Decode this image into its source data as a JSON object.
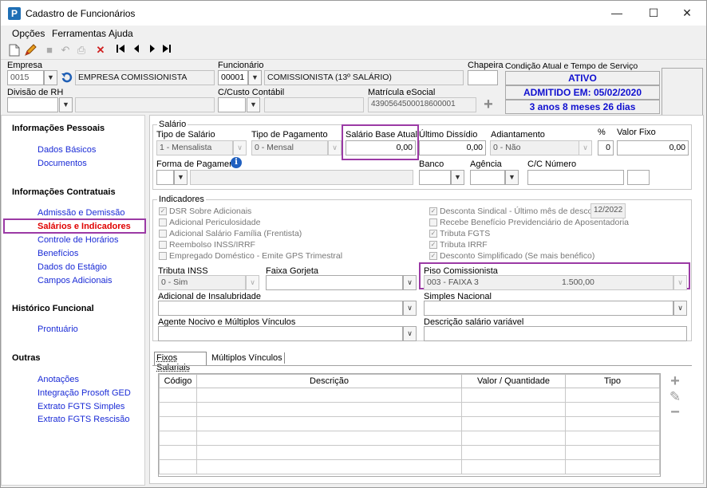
{
  "window": {
    "title": "Cadastro de Funcionários",
    "app_icon": "P"
  },
  "menu": [
    {
      "label": "Opções",
      "accel": "O"
    },
    {
      "label": "Ferramentas",
      "accel": "F"
    },
    {
      "label": "Ajuda",
      "accel": "A"
    }
  ],
  "header": {
    "empresa_label": "Empresa",
    "empresa_code": "0015",
    "empresa_name": "EMPRESA COMISSIONISTA",
    "funcionario_label": "Funcionário",
    "funcionario_code": "00001",
    "funcionario_name": "COMISSIONISTA  (13º SALÁRIO)",
    "chapeira_label": "Chapeira",
    "chapeira_value": "",
    "condicao_label": "Condição Atual e Tempo de Serviço",
    "status": "ATIVO",
    "admitido": "ADMITIDO EM: 05/02/2020",
    "tempo": "3 anos 8 meses 26 dias",
    "divisao_label": "Divisão de RH",
    "divisao_value": "",
    "ccusto_label": "C/Custo Contábil",
    "ccusto_value": "",
    "matricula_label": "Matrícula eSocial",
    "matricula_value": "4390564500018600001"
  },
  "sidebar": {
    "sections": [
      {
        "title": "Informações Pessoais",
        "items": [
          "Dados Básicos",
          "Documentos"
        ]
      },
      {
        "title": "Informações Contratuais",
        "items": [
          "Admissão e Demissão",
          "Salários e Indicadores",
          "Controle de Horários",
          "Benefícios",
          "Dados do Estágio",
          "Campos Adicionais"
        ]
      },
      {
        "title": "Histórico Funcional",
        "items": [
          "Prontuário"
        ]
      },
      {
        "title": "Outras",
        "items": [
          "Anotações",
          "Integração Prosoft GED",
          "Extrato FGTS Simples",
          "Extrato FGTS Rescisão"
        ]
      }
    ],
    "active": "Salários e Indicadores"
  },
  "salario": {
    "group_title": "Salário",
    "tipo_salario_label": "Tipo de Salário",
    "tipo_salario_value": "1 - Mensalista",
    "tipo_pagamento_label": "Tipo de Pagamento",
    "tipo_pagamento_value": "0 - Mensal",
    "salario_base_label": "Salário Base Atual",
    "salario_base_value": "0,00",
    "ultimo_dissidio_label": "Último Dissídio",
    "ultimo_dissidio_value": "0,00",
    "adiantamento_label": "Adiantamento",
    "adiantamento_value": "0 - Não",
    "percent_label": "%",
    "percent_value": "0",
    "valor_fixo_label": "Valor Fixo",
    "valor_fixo_value": "0,00",
    "forma_pagamento_label": "Forma de Pagamento",
    "banco_label": "Banco",
    "agencia_label": "Agência",
    "cc_label": "C/C Número"
  },
  "indicadores": {
    "group_title": "Indicadores",
    "left_checks": [
      {
        "label": "DSR Sobre Adicionais",
        "checked": true
      },
      {
        "label": "Adicional Periculosidade",
        "checked": false
      },
      {
        "label": "Adicional Salário Família (Frentista)",
        "checked": false
      },
      {
        "label": "Reembolso INSS/IRRF",
        "checked": false
      },
      {
        "label": "Empregado Doméstico - Emite GPS Trimestral",
        "checked": false
      }
    ],
    "right_checks": [
      {
        "label": "Desconta Sindical - Último mês de desconto",
        "checked": true
      },
      {
        "label": "Recebe Benefício Previdenciário de Aposentadoria",
        "checked": false
      },
      {
        "label": "Tributa FGTS",
        "checked": true
      },
      {
        "label": "Tributa IRRF",
        "checked": true
      },
      {
        "label": "Desconto Simplificado (Se mais benéfico)",
        "checked": true
      }
    ],
    "sindical_mes": "12/2022",
    "tributa_inss_label": "Tributa INSS",
    "tributa_inss_value": "0 - Sim",
    "faixa_gorjeta_label": "Faixa Gorjeta",
    "piso_label": "Piso Comissionista",
    "piso_code": "003 - FAIXA 3",
    "piso_value": "1.500,00",
    "insalubridade_label": "Adicional de Insalubridade",
    "simples_label": "Simples Nacional",
    "agente_label": "Agente Nocivo e  Múltiplos Vínculos",
    "desc_variavel_label": "Descrição salário variável"
  },
  "tabs": [
    {
      "label": "Fixos Salariais",
      "active": true
    },
    {
      "label": "Múltiplos Vínculos",
      "active": false
    }
  ],
  "grid": {
    "columns": [
      "Código",
      "Descrição",
      "Valor / Quantidade",
      "Tipo"
    ],
    "rows": 6
  },
  "icons": {
    "new": "new-document-icon",
    "edit": "edit-icon",
    "close": "close-x-icon",
    "first": "first-record-icon",
    "prev": "previous-record-icon",
    "next": "next-record-icon",
    "last": "last-record-icon",
    "info": "info-icon",
    "add": "plus-icon"
  }
}
